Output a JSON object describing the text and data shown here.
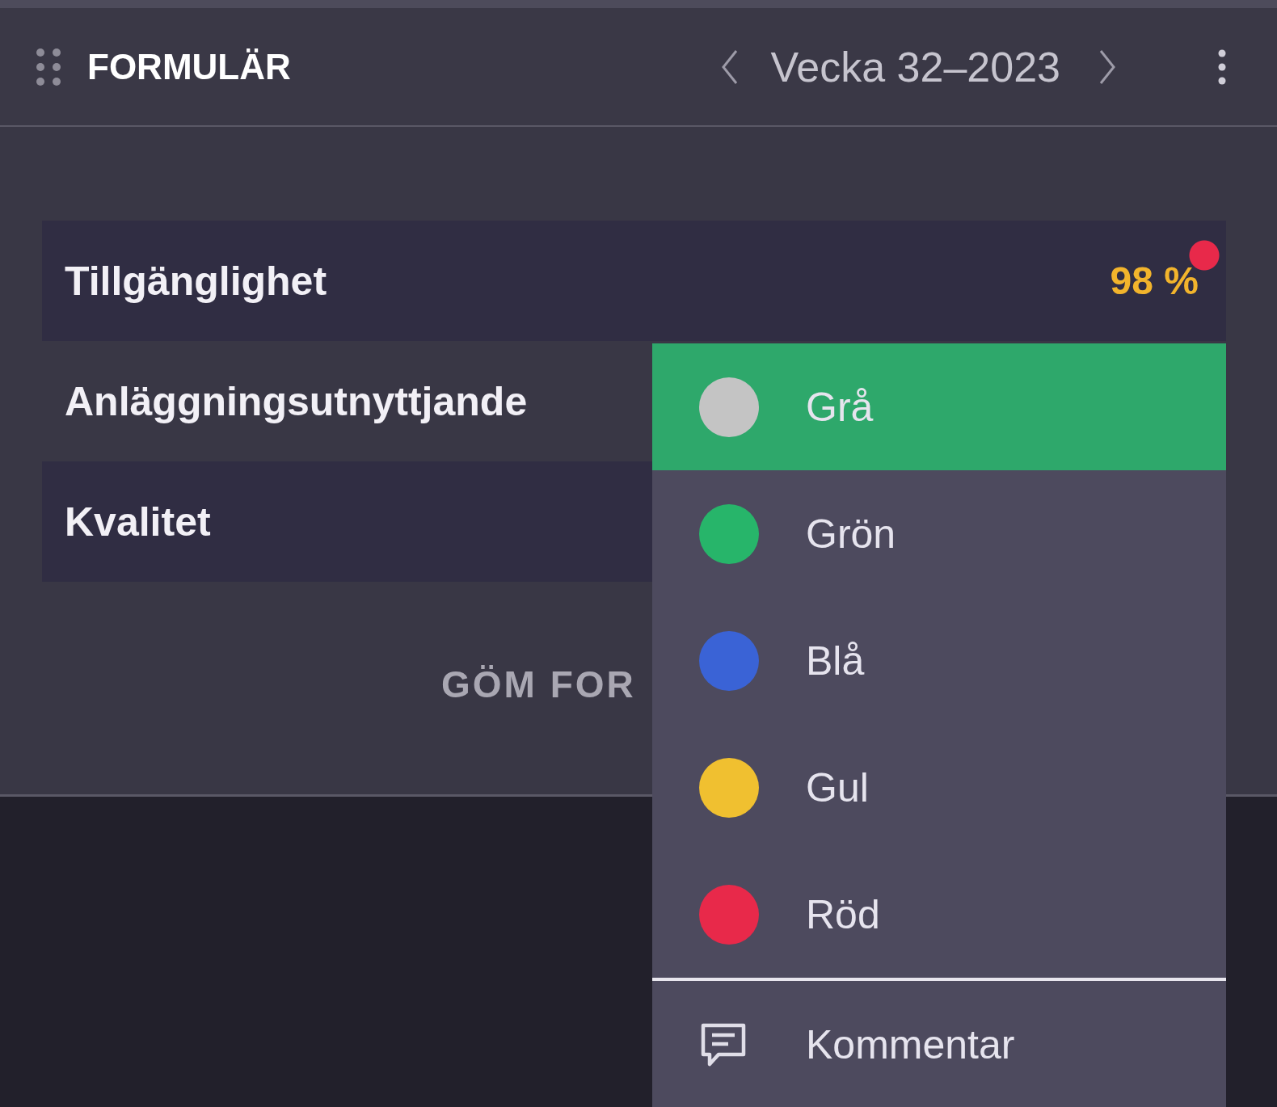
{
  "header": {
    "title": "FORMULÄR",
    "period": "Vecka 32–2023"
  },
  "rows": [
    {
      "label": "Tillgänglighet",
      "value": "98 %",
      "alert": true
    },
    {
      "label": "Anläggningsutnyttjande"
    },
    {
      "label": "Kvalitet"
    }
  ],
  "hide_button": "GÖM FOR",
  "menu": {
    "items": [
      {
        "label": "Grå",
        "color": "#c4c4c4",
        "selected": true
      },
      {
        "label": "Grön",
        "color": "#27b56a",
        "selected": false
      },
      {
        "label": "Blå",
        "color": "#3a63d6",
        "selected": false
      },
      {
        "label": "Gul",
        "color": "#f0c030",
        "selected": false
      },
      {
        "label": "Röd",
        "color": "#e8294a",
        "selected": false
      }
    ],
    "comment": "Kommentar"
  }
}
